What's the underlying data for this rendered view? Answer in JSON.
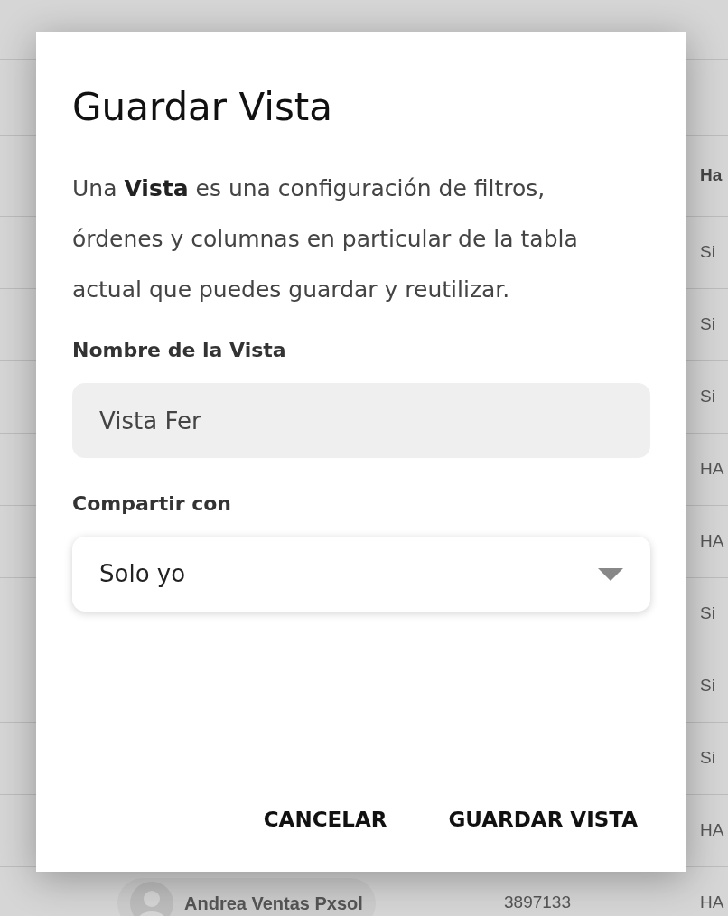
{
  "background_table": {
    "header": {
      "column_3": "Ha"
    },
    "rows": [
      {
        "column_3": "Si"
      },
      {
        "column_3": "Si"
      },
      {
        "column_3": "Si"
      },
      {
        "column_3": "HA"
      },
      {
        "column_3": "HA"
      },
      {
        "column_3": "Si"
      },
      {
        "column_3": "Si"
      },
      {
        "column_3": "Si"
      },
      {
        "column_3": "HA"
      },
      {
        "user": "Andrea Ventas Pxsol",
        "column_2": "3897133",
        "column_3": "HA"
      }
    ]
  },
  "dialog": {
    "title": "Guardar Vista",
    "description": "Una **Vista** es una configuración de filtros, órdenes y columnas en particular de la tabla actual que puedes guardar y reutilizar.",
    "name_field": {
      "label": "Nombre de la Vista",
      "value": "Vista Fer"
    },
    "share_field": {
      "label": "Compartir con",
      "value": "Solo yo"
    },
    "buttons": [
      "CANCELAR",
      "GUARDAR VISTA"
    ]
  }
}
